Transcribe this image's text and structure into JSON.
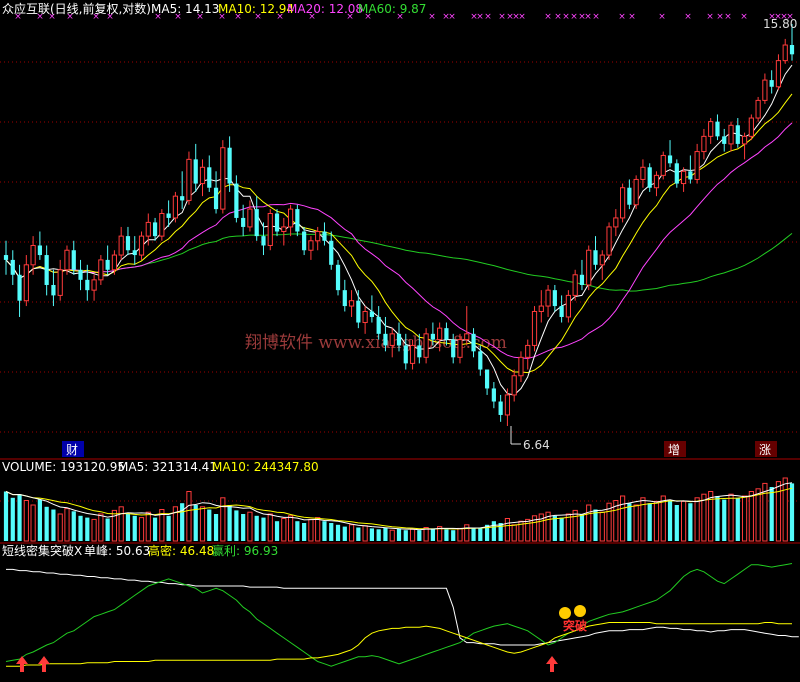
{
  "main_header": {
    "title": "众应互联(日线,前复权,对数)",
    "ma5": "MA5: 14.13",
    "ma10": "MA10: 12.94",
    "ma20": "MA20: 12.08",
    "ma60": "MA60: 9.87"
  },
  "volume_header": {
    "title": "VOLUME: 193120.95",
    "ma5": "MA5: 321314.41",
    "ma10": "MA10: 244347.80"
  },
  "indicator_header": {
    "title": "短线密集突破X",
    "single_peak": "单峰: 50.63",
    "high_density": "高密: 46.48",
    "profit": "赢利: 96.93"
  },
  "watermark": "翔博软件 www.xiangbosoft.com",
  "markers": {
    "cai": "财",
    "zeng": "增",
    "zhang": "涨"
  },
  "breakout_text": "突破",
  "colors": {
    "up": "#ff3b3b",
    "down": "#54fcfc",
    "ma5": "#ffffff",
    "ma10": "#ffff00",
    "ma20": "#ff44ff",
    "ma60": "#22cc22",
    "grid": "#a00000"
  },
  "chart_data": [
    {
      "type": "candlestick",
      "price_labels": {
        "high": "15.80",
        "low": "6.64"
      },
      "high": 15.8,
      "low": 6.64,
      "ohlc": [
        [
          9.6,
          9.9,
          9.2,
          9.5
        ],
        [
          9.5,
          9.7,
          9.0,
          9.2
        ],
        [
          9.2,
          9.4,
          8.4,
          8.7
        ],
        [
          8.7,
          9.6,
          8.6,
          9.4
        ],
        [
          9.4,
          10.0,
          9.2,
          9.8
        ],
        [
          9.8,
          10.1,
          9.5,
          9.6
        ],
        [
          9.6,
          9.8,
          8.8,
          9.0
        ],
        [
          9.0,
          9.3,
          8.6,
          8.8
        ],
        [
          8.8,
          9.5,
          8.7,
          9.3
        ],
        [
          9.3,
          9.8,
          9.2,
          9.7
        ],
        [
          9.7,
          9.9,
          9.2,
          9.3
        ],
        [
          9.3,
          9.5,
          8.9,
          9.1
        ],
        [
          9.1,
          9.4,
          8.7,
          8.9
        ],
        [
          8.9,
          9.2,
          8.7,
          9.1
        ],
        [
          9.1,
          9.6,
          9.0,
          9.5
        ],
        [
          9.5,
          9.8,
          9.2,
          9.3
        ],
        [
          9.3,
          9.7,
          9.2,
          9.6
        ],
        [
          9.6,
          10.2,
          9.5,
          10.0
        ],
        [
          10.0,
          10.2,
          9.6,
          9.7
        ],
        [
          9.7,
          10.0,
          9.4,
          9.6
        ],
        [
          9.6,
          10.1,
          9.5,
          10.0
        ],
        [
          10.0,
          10.5,
          9.8,
          10.3
        ],
        [
          10.3,
          10.4,
          9.9,
          10.0
        ],
        [
          10.0,
          10.6,
          9.9,
          10.5
        ],
        [
          10.5,
          10.8,
          10.2,
          10.4
        ],
        [
          10.4,
          11.0,
          10.3,
          10.9
        ],
        [
          10.9,
          11.5,
          10.6,
          10.8
        ],
        [
          10.8,
          12.0,
          10.7,
          11.8
        ],
        [
          11.8,
          12.2,
          11.0,
          11.2
        ],
        [
          11.2,
          11.8,
          10.9,
          11.6
        ],
        [
          11.6,
          11.9,
          11.0,
          11.1
        ],
        [
          11.1,
          11.5,
          10.5,
          10.6
        ],
        [
          10.6,
          12.3,
          10.5,
          12.1
        ],
        [
          12.1,
          12.4,
          11.0,
          11.2
        ],
        [
          11.2,
          11.4,
          10.3,
          10.4
        ],
        [
          10.4,
          10.7,
          10.0,
          10.2
        ],
        [
          10.2,
          10.8,
          10.1,
          10.6
        ],
        [
          10.6,
          10.9,
          9.9,
          10.0
        ],
        [
          10.0,
          10.3,
          9.6,
          9.8
        ],
        [
          9.8,
          10.6,
          9.7,
          10.5
        ],
        [
          10.5,
          10.6,
          10.0,
          10.1
        ],
        [
          10.1,
          10.4,
          9.8,
          10.2
        ],
        [
          10.2,
          10.7,
          10.0,
          10.6
        ],
        [
          10.6,
          10.7,
          10.0,
          10.1
        ],
        [
          10.1,
          10.2,
          9.6,
          9.7
        ],
        [
          9.7,
          10.0,
          9.5,
          9.9
        ],
        [
          9.9,
          10.2,
          9.7,
          10.1
        ],
        [
          10.1,
          10.3,
          9.8,
          9.9
        ],
        [
          9.9,
          10.1,
          9.3,
          9.4
        ],
        [
          9.4,
          9.5,
          8.8,
          8.9
        ],
        [
          8.9,
          9.1,
          8.5,
          8.6
        ],
        [
          8.6,
          8.9,
          8.4,
          8.7
        ],
        [
          8.7,
          8.9,
          8.2,
          8.3
        ],
        [
          8.3,
          8.6,
          8.1,
          8.5
        ],
        [
          8.5,
          8.8,
          8.3,
          8.4
        ],
        [
          8.4,
          8.6,
          8.0,
          8.1
        ],
        [
          8.1,
          8.4,
          7.8,
          7.9
        ],
        [
          7.9,
          8.2,
          7.7,
          8.1
        ],
        [
          8.1,
          8.3,
          7.8,
          7.9
        ],
        [
          7.9,
          8.1,
          7.5,
          7.6
        ],
        [
          7.6,
          8.0,
          7.5,
          7.9
        ],
        [
          7.9,
          8.1,
          7.6,
          7.7
        ],
        [
          7.7,
          8.2,
          7.6,
          8.1
        ],
        [
          8.1,
          8.3,
          7.9,
          8.0
        ],
        [
          8.0,
          8.3,
          7.8,
          8.2
        ],
        [
          8.2,
          8.3,
          7.9,
          8.0
        ],
        [
          8.0,
          8.1,
          7.6,
          7.7
        ],
        [
          7.7,
          8.1,
          7.6,
          8.0
        ],
        [
          8.0,
          8.6,
          7.9,
          8.1
        ],
        [
          8.1,
          8.2,
          7.7,
          7.8
        ],
        [
          7.8,
          7.9,
          7.4,
          7.5
        ],
        [
          7.5,
          7.5,
          7.1,
          7.2
        ],
        [
          7.2,
          7.3,
          6.9,
          7.0
        ],
        [
          7.0,
          7.1,
          6.7,
          6.8
        ],
        [
          6.8,
          7.2,
          6.64,
          7.1
        ],
        [
          7.1,
          7.5,
          7.0,
          7.4
        ],
        [
          7.4,
          7.8,
          7.3,
          7.7
        ],
        [
          7.7,
          8.0,
          7.5,
          7.9
        ],
        [
          7.9,
          8.6,
          7.8,
          8.5
        ],
        [
          8.5,
          8.9,
          8.3,
          8.6
        ],
        [
          8.6,
          9.0,
          8.4,
          8.9
        ],
        [
          8.9,
          9.0,
          8.5,
          8.6
        ],
        [
          8.6,
          8.8,
          8.3,
          8.4
        ],
        [
          8.4,
          8.9,
          8.3,
          8.8
        ],
        [
          8.8,
          9.3,
          8.7,
          9.2
        ],
        [
          9.2,
          9.5,
          8.9,
          9.0
        ],
        [
          9.0,
          9.8,
          8.9,
          9.7
        ],
        [
          9.7,
          10.0,
          9.3,
          9.4
        ],
        [
          9.4,
          9.7,
          9.1,
          9.6
        ],
        [
          9.6,
          10.3,
          9.5,
          10.2
        ],
        [
          10.2,
          10.6,
          10.0,
          10.4
        ],
        [
          10.4,
          11.2,
          10.3,
          11.1
        ],
        [
          11.1,
          11.3,
          10.6,
          10.7
        ],
        [
          10.7,
          11.4,
          10.6,
          11.3
        ],
        [
          11.3,
          11.8,
          11.1,
          11.6
        ],
        [
          11.6,
          11.7,
          11.0,
          11.1
        ],
        [
          11.1,
          11.5,
          10.9,
          11.4
        ],
        [
          11.4,
          12.0,
          11.3,
          11.9
        ],
        [
          11.9,
          12.3,
          11.6,
          11.7
        ],
        [
          11.7,
          11.8,
          11.1,
          11.2
        ],
        [
          11.2,
          11.6,
          11.0,
          11.5
        ],
        [
          11.5,
          11.9,
          11.2,
          11.3
        ],
        [
          11.3,
          12.2,
          11.2,
          12.0
        ],
        [
          12.0,
          12.6,
          11.8,
          12.4
        ],
        [
          12.4,
          12.9,
          12.2,
          12.8
        ],
        [
          12.8,
          13.0,
          12.3,
          12.4
        ],
        [
          12.4,
          12.6,
          12.0,
          12.2
        ],
        [
          12.2,
          12.8,
          12.0,
          12.7
        ],
        [
          12.7,
          12.9,
          12.1,
          12.2
        ],
        [
          12.2,
          12.5,
          11.8,
          12.4
        ],
        [
          12.4,
          13.0,
          12.3,
          12.9
        ],
        [
          12.9,
          13.5,
          12.8,
          13.4
        ],
        [
          13.4,
          14.2,
          13.3,
          14.0
        ],
        [
          14.0,
          14.3,
          13.6,
          13.8
        ],
        [
          13.8,
          14.8,
          13.7,
          14.6
        ],
        [
          14.6,
          15.3,
          14.5,
          15.1
        ],
        [
          15.1,
          15.8,
          14.6,
          14.8
        ]
      ]
    },
    {
      "type": "bar",
      "name": "VOLUME",
      "values": [
        55,
        48,
        52,
        45,
        40,
        46,
        38,
        35,
        30,
        36,
        33,
        28,
        26,
        24,
        30,
        25,
        34,
        38,
        30,
        28,
        26,
        32,
        26,
        35,
        28,
        38,
        42,
        55,
        40,
        38,
        35,
        30,
        48,
        40,
        34,
        30,
        32,
        28,
        26,
        30,
        22,
        25,
        28,
        22,
        20,
        24,
        26,
        22,
        20,
        18,
        16,
        18,
        15,
        17,
        14,
        13,
        15,
        12,
        14,
        12,
        13,
        12,
        15,
        14,
        16,
        13,
        12,
        14,
        18,
        15,
        14,
        18,
        22,
        20,
        25,
        18,
        22,
        24,
        28,
        30,
        32,
        28,
        26,
        30,
        34,
        30,
        40,
        35,
        32,
        42,
        45,
        50,
        42,
        40,
        48,
        42,
        44,
        50,
        45,
        40,
        44,
        42,
        48,
        52,
        55,
        50,
        46,
        52,
        48,
        50,
        55,
        58,
        64,
        60,
        66,
        70,
        64
      ]
    },
    {
      "type": "line",
      "series": [
        {
          "values": [
            92,
            92,
            91,
            91,
            90,
            90,
            89,
            89,
            88,
            88,
            87,
            87,
            86,
            86,
            85,
            85,
            84,
            84,
            83,
            83,
            82,
            82,
            81,
            81,
            80,
            80,
            79,
            79,
            78,
            78,
            78,
            78,
            78,
            78,
            78,
            78,
            77,
            77,
            77,
            77,
            77,
            76,
            76,
            76,
            76,
            76,
            76,
            76,
            76,
            76,
            76,
            76,
            76,
            76,
            76,
            76,
            76,
            76,
            76,
            76,
            76,
            76,
            76,
            76,
            76,
            76,
            60,
            34,
            30,
            30,
            29,
            29,
            29,
            28,
            28,
            28,
            28,
            28,
            28,
            29,
            30,
            31,
            32,
            33,
            34,
            35,
            36,
            38,
            39,
            40,
            40,
            40,
            41,
            41,
            41,
            42,
            43,
            43,
            42,
            42,
            41,
            41,
            40,
            40,
            39,
            40,
            40,
            41,
            41,
            41,
            40,
            39,
            38,
            37,
            36,
            36,
            35,
            35
          ]
        },
        {
          "values": [
            14,
            15,
            16,
            20,
            22,
            25,
            28,
            30,
            34,
            38,
            40,
            44,
            48,
            52,
            54,
            56,
            58,
            62,
            66,
            70,
            74,
            78,
            80,
            82,
            84,
            82,
            80,
            78,
            76,
            72,
            74,
            76,
            74,
            70,
            66,
            60,
            56,
            50,
            46,
            42,
            38,
            34,
            30,
            26,
            22,
            18,
            14,
            12,
            10,
            12,
            14,
            16,
            18,
            18,
            19,
            18,
            16,
            14,
            12,
            14,
            16,
            18,
            20,
            22,
            24,
            26,
            28,
            30,
            34,
            38,
            40,
            42,
            44,
            45,
            46,
            44,
            42,
            40,
            36,
            32,
            28,
            30,
            34,
            38,
            40,
            44,
            48,
            50,
            52,
            54,
            55,
            56,
            58,
            60,
            62,
            64,
            66,
            70,
            74,
            80,
            86,
            90,
            92,
            90,
            86,
            82,
            80,
            84,
            88,
            92,
            96,
            96,
            95,
            94,
            95,
            96,
            97
          ]
        },
        {
          "values": [
            10,
            10,
            10,
            11,
            11,
            11,
            12,
            12,
            12,
            12,
            12,
            12,
            13,
            13,
            13,
            13,
            14,
            14,
            14,
            14,
            14,
            14,
            15,
            15,
            15,
            15,
            15,
            15,
            15,
            15,
            15,
            15,
            15,
            15,
            15,
            15,
            15,
            15,
            15,
            15,
            16,
            16,
            16,
            16,
            16,
            17,
            17,
            18,
            19,
            20,
            22,
            24,
            28,
            34,
            38,
            40,
            41,
            42,
            42,
            43,
            43,
            43,
            44,
            43,
            42,
            40,
            38,
            36,
            34,
            32,
            30,
            28,
            26,
            24,
            22,
            21,
            22,
            24,
            26,
            28,
            30,
            34,
            36,
            38,
            40,
            42,
            44,
            45,
            46,
            47,
            47,
            47,
            47,
            47,
            47,
            47,
            46,
            46,
            46,
            46,
            46,
            46,
            46,
            46,
            46,
            46,
            46,
            46,
            46,
            46,
            46,
            46,
            47,
            47,
            46,
            46,
            46
          ]
        }
      ]
    }
  ]
}
